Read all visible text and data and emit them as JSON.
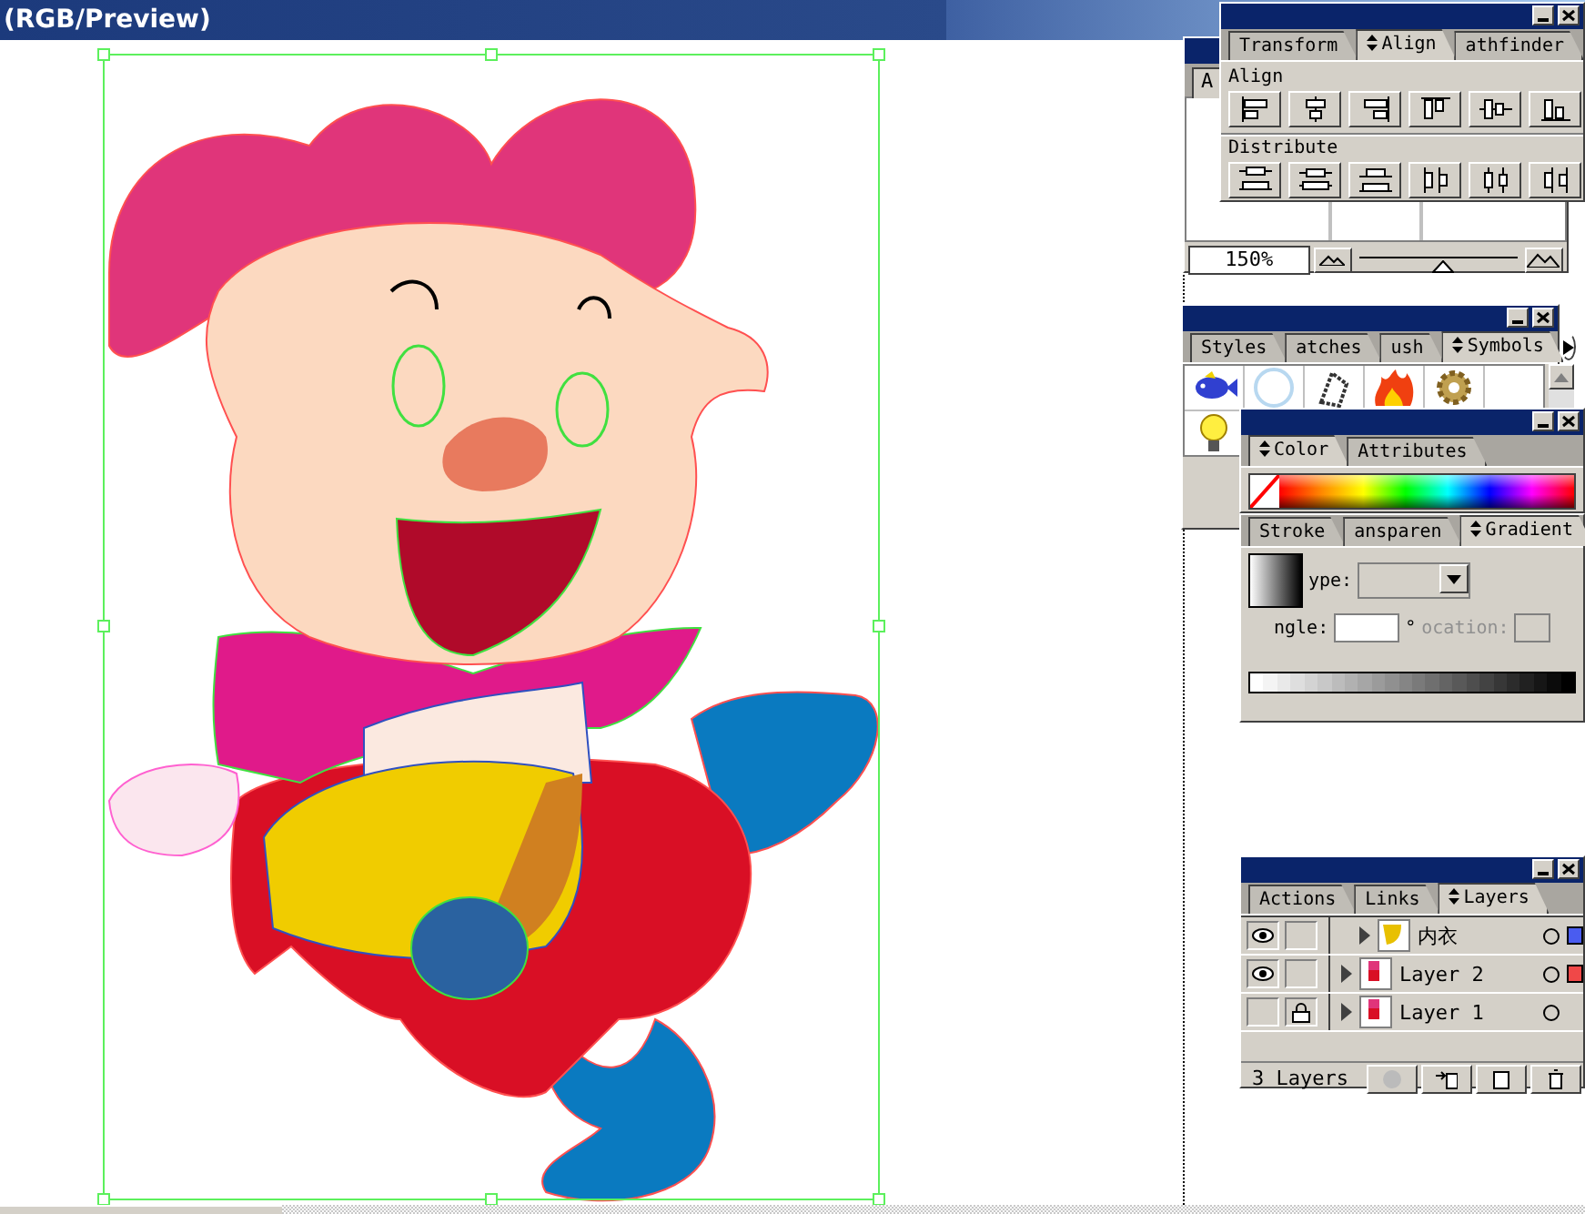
{
  "window": {
    "title": "(RGB/Preview)"
  },
  "navigator": {
    "tab": "A",
    "zoom": "150%",
    "zoom_slider": {
      "level": 0.5
    }
  },
  "align_panel": {
    "tabs": [
      {
        "label": "Transform",
        "selected": false
      },
      {
        "label": "Align",
        "selected": true
      },
      {
        "label": "athfinder",
        "selected": false
      }
    ],
    "align_label": "Align",
    "distribute_label": "Distribute"
  },
  "symbols_panel": {
    "tabs": [
      {
        "label": "Styles",
        "selected": false
      },
      {
        "label": "atches",
        "selected": false
      },
      {
        "label": "ush",
        "selected": false
      },
      {
        "label": "Symbols",
        "selected": true
      }
    ]
  },
  "color_panel": {
    "tabs": [
      {
        "label": "Color",
        "selected": true
      },
      {
        "label": "Attributes",
        "selected": false
      }
    ]
  },
  "gradient_panel": {
    "tabs": [
      {
        "label": "Stroke",
        "selected": false
      },
      {
        "label": "ansparen",
        "selected": false
      },
      {
        "label": "Gradient",
        "selected": true
      }
    ],
    "type_label": "ype:",
    "angle_label": "ngle:",
    "degree_sign": "°",
    "location_label": "ocation:",
    "location_disabled": true
  },
  "layers_panel": {
    "tabs": [
      {
        "label": "Actions",
        "selected": false
      },
      {
        "label": "Links",
        "selected": false
      },
      {
        "label": "Layers",
        "selected": true
      }
    ],
    "layers": [
      {
        "kind": "sublayer",
        "name": "内衣",
        "visible": true,
        "locked": false,
        "color": "#4a5cf0"
      },
      {
        "kind": "layer",
        "name": "Layer 2",
        "visible": true,
        "locked": false,
        "color": "#f04848"
      },
      {
        "kind": "layer",
        "name": "Layer 1",
        "visible": false,
        "locked": true
      }
    ],
    "count": "3 Layers"
  }
}
